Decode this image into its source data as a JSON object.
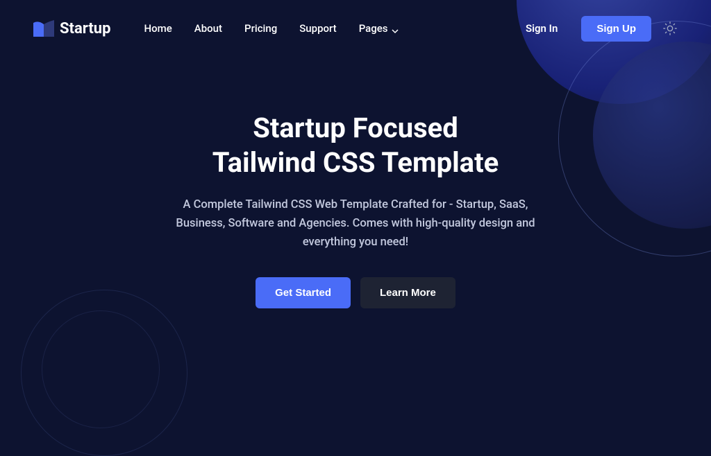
{
  "brand": {
    "name": "Startup"
  },
  "nav": {
    "items": [
      {
        "label": "Home"
      },
      {
        "label": "About"
      },
      {
        "label": "Pricing"
      },
      {
        "label": "Support"
      },
      {
        "label": "Pages"
      }
    ]
  },
  "header": {
    "signin": "Sign In",
    "signup": "Sign Up"
  },
  "hero": {
    "title_line1": "Startup Focused",
    "title_line2": "Tailwind CSS Template",
    "subtitle": "A Complete Tailwind CSS Web Template Crafted for - Startup, SaaS, Business, Software and Agencies. Comes with high-quality design and everything you need!",
    "cta_primary": "Get Started",
    "cta_secondary": "Learn More"
  }
}
